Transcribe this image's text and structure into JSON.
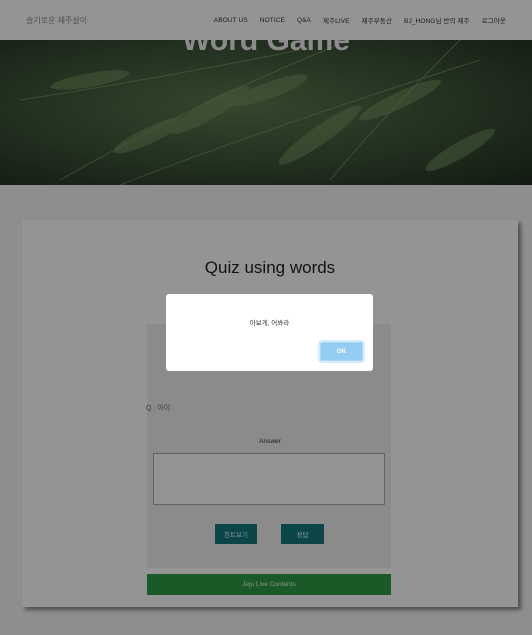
{
  "navbar": {
    "brand": "슬기로운 제주살이",
    "items": [
      "ABOUT US",
      "NOTICE",
      "Q&A",
      "제주LIVE",
      "제주부동산",
      "BJ_HONG님 반의 제주",
      "로그아웃"
    ]
  },
  "hero": {
    "title": "Word Game"
  },
  "quiz": {
    "title": "Quiz using words",
    "question": "Q : 아이",
    "answer_label": "Answer",
    "answer_value": "",
    "hint_button": "힌트보기",
    "answer_button": "정답",
    "live_button": "Jeju Live Contents"
  },
  "dialog": {
    "message": "아보게, 어봐라",
    "ok_label": "OK"
  },
  "colors": {
    "teal": "#15797e",
    "green": "#2e9a45",
    "ok": "#93cdf3"
  }
}
